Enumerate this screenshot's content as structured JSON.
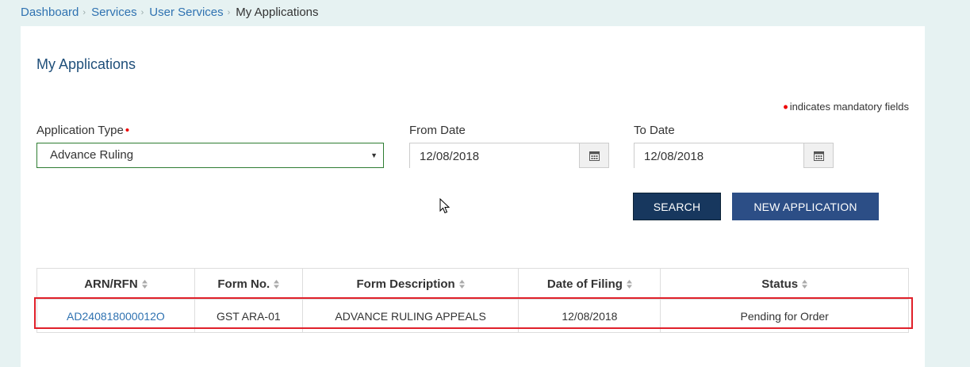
{
  "breadcrumb": {
    "items": [
      "Dashboard",
      "Services",
      "User Services"
    ],
    "current": "My Applications"
  },
  "page": {
    "title": "My Applications",
    "mandatory_note": "indicates mandatory fields"
  },
  "form": {
    "application_type_label": "Application Type",
    "application_type_value": "Advance Ruling",
    "from_date_label": "From Date",
    "from_date_value": "12/08/2018",
    "to_date_label": "To Date",
    "to_date_value": "12/08/2018",
    "search_label": "SEARCH",
    "new_application_label": "NEW APPLICATION"
  },
  "table": {
    "headers": [
      "ARN/RFN",
      "Form No.",
      "Form Description",
      "Date of Filing",
      "Status"
    ],
    "rows": [
      [
        "AD240818000012O",
        "GST ARA-01",
        "ADVANCE RULING APPEALS",
        "12/08/2018",
        "Pending for Order"
      ]
    ]
  },
  "icons": {
    "calendar": "calendar-icon",
    "sort": "sort-icon",
    "dropdown": "chevron-down-icon"
  },
  "colors": {
    "link": "#2f72b1",
    "primary_button": "#17375e",
    "secondary_button": "#2c4e86",
    "highlight": "#e0202a",
    "required": "#e00000"
  }
}
